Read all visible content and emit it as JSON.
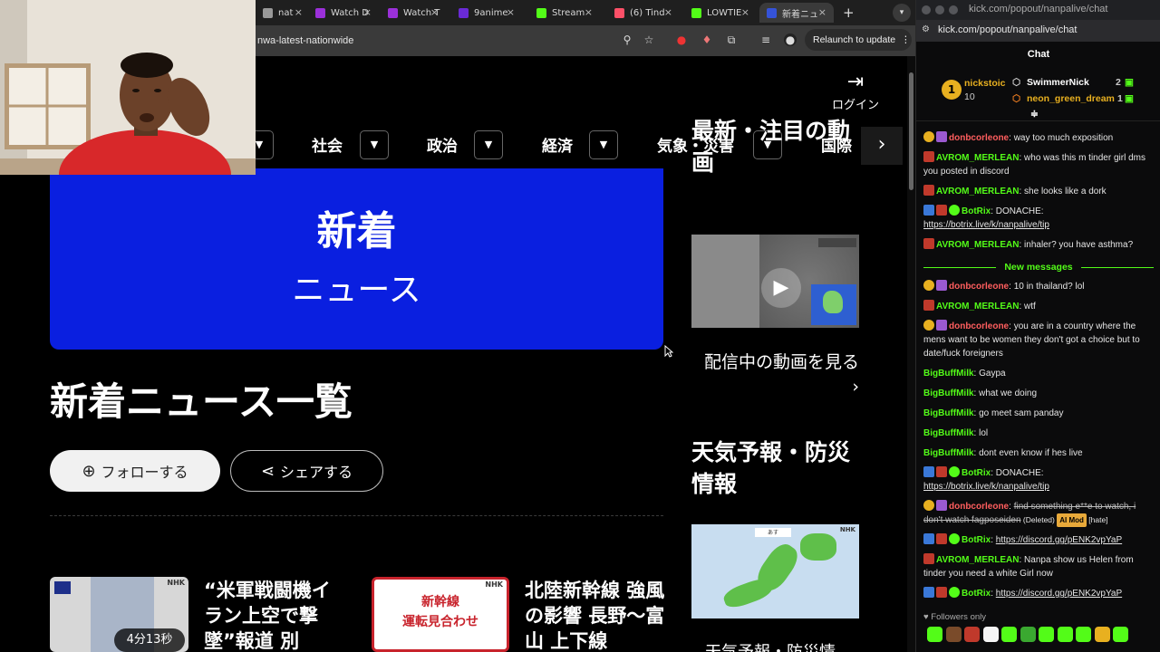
{
  "browser": {
    "tabs": [
      {
        "label": "nat",
        "fav": "#999999"
      },
      {
        "label": "Watch D",
        "fav": "#9b30d9"
      },
      {
        "label": "Watch T",
        "fav": "#9b30d9"
      },
      {
        "label": "9anime",
        "fav": "#6a2ad6"
      },
      {
        "label": "Stream",
        "fav": "#53fc18"
      },
      {
        "label": "(6) Tind",
        "fav": "#fd5068"
      },
      {
        "label": "LOWTIE",
        "fav": "#53fc18"
      },
      {
        "label": "新着ニュ",
        "fav": "#3553d8"
      }
    ],
    "url": "nwa-latest-nationwide",
    "relaunch_label": "Relaunch to update"
  },
  "site": {
    "login_label": "ログイン",
    "nav_items": [
      "社会",
      "政治",
      "経済",
      "気象・災害",
      "国際"
    ],
    "hero_line1": "新着",
    "hero_line2": "ニュース",
    "page_title": "新着ニュース一覧",
    "follow_label": "フォローする",
    "share_label": "シェアする",
    "news": [
      {
        "headline": "“米軍戦闘機イラン上空で撃墜”報道 別",
        "duration": "4分13秒"
      },
      {
        "headline": "北陸新幹線 強風の影響 長野〜富山 上下線",
        "thumb_text": "新幹線\n運転見合わせ"
      }
    ],
    "sidebar": {
      "featured_title": "最新・注目の動画",
      "watch_live_label": "配信中の動画を見る",
      "weather_title": "天気予報・防災情報",
      "weather_sub": "天気予報・防災情"
    }
  },
  "chat": {
    "window_url": "kick.com/popout/nanpalive/chat",
    "url": "kick.com/popout/nanpalive/chat",
    "header": "Chat",
    "leaderboard": [
      {
        "name": "nickstoic",
        "count": "10",
        "rank": "1"
      },
      {
        "name": "SwimmerNick",
        "count": "2"
      },
      {
        "name": "neon_green_dream",
        "count": "1"
      }
    ],
    "new_messages_label": "New messages",
    "messages": [
      {
        "user": "donbcorleone",
        "color": "#ff5e5e",
        "text": "way too much exposition",
        "badges": [
          "sub",
          "purple"
        ]
      },
      {
        "user": "AVROM_MERLEAN",
        "color": "#53fc18",
        "text": "who was this m tinder girl dms you posted in discord",
        "badges": [
          "red"
        ]
      },
      {
        "user": "AVROM_MERLEAN",
        "color": "#53fc18",
        "text": "she looks like a dork",
        "badges": [
          "red"
        ]
      },
      {
        "user": "BotRix",
        "color": "#53fc18",
        "text": "DONACHE: ",
        "link": "https://botrix.live/k/nanpalive/tip",
        "badges": [
          "blue",
          "red",
          "verified"
        ]
      },
      {
        "user": "AVROM_MERLEAN",
        "color": "#53fc18",
        "text": "inhaler? you have asthma?",
        "badges": [
          "red"
        ]
      },
      {
        "user": "donbcorleone",
        "color": "#ff5e5e",
        "text": "10 in thailand? lol",
        "badges": [
          "sub",
          "purple"
        ]
      },
      {
        "user": "AVROM_MERLEAN",
        "color": "#53fc18",
        "text": "wtf",
        "badges": [
          "red"
        ]
      },
      {
        "user": "donbcorleone",
        "color": "#ff5e5e",
        "text": "you are in a country where the mens want to be women they don't got a choice but to date/fuck foreigners",
        "badges": [
          "sub",
          "purple"
        ]
      },
      {
        "user": "BigBuffMilk",
        "color": "#53fc18",
        "text": "Gaypa",
        "badges": []
      },
      {
        "user": "BigBuffMilk",
        "color": "#53fc18",
        "text": "what we doing",
        "badges": []
      },
      {
        "user": "BigBuffMilk",
        "color": "#53fc18",
        "text": "go meet sam panday",
        "badges": []
      },
      {
        "user": "BigBuffMilk",
        "color": "#53fc18",
        "text": "lol",
        "badges": []
      },
      {
        "user": "BigBuffMilk",
        "color": "#53fc18",
        "text": "dont even know if hes live",
        "badges": []
      },
      {
        "user": "BotRix",
        "color": "#53fc18",
        "text": "DONACHE: ",
        "link": "https://botrix.live/k/nanpalive/tip",
        "badges": [
          "blue",
          "red",
          "verified"
        ]
      },
      {
        "user": "donbcorleone",
        "color": "#ff5e5e",
        "deleted_text": "find something e**e to watch, i don't watch fagposeiden",
        "deleted_label": "(Deleted)",
        "mod_tag": "AI Mod",
        "reason": "[hate]",
        "badges": [
          "sub",
          "purple"
        ]
      },
      {
        "user": "BotRix",
        "color": "#53fc18",
        "text": "",
        "link": "https://discord.gg/pENK2vpYaP",
        "badges": [
          "blue",
          "red",
          "verified"
        ]
      },
      {
        "user": "AVROM_MERLEAN",
        "color": "#53fc18",
        "text": "Nanpa show us Helen from tinder you need a white Girl now",
        "badges": [
          "red"
        ]
      },
      {
        "user": "BotRix",
        "color": "#53fc18",
        "text": "",
        "link": "https://discord.gg/pENK2vpYaP",
        "badges": [
          "blue",
          "red",
          "verified"
        ]
      }
    ],
    "followers_only_label": "Followers only"
  },
  "colors": {
    "kick_green": "#53fc18",
    "nhk_blue": "#0a1fe0"
  }
}
